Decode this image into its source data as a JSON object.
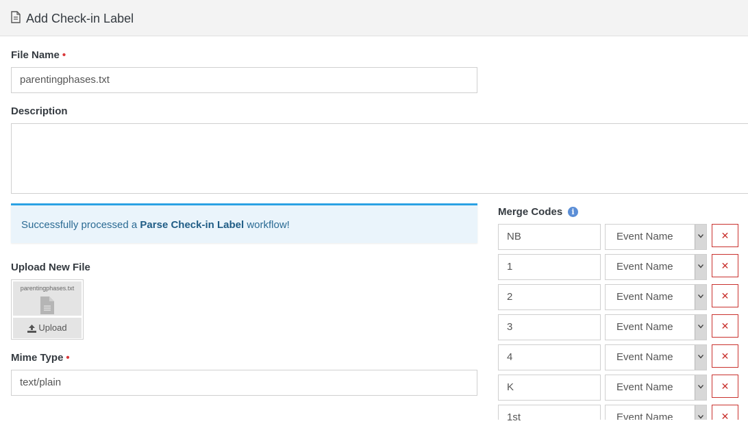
{
  "header": {
    "title": "Add Check-in Label",
    "icon": "file-text-icon"
  },
  "form": {
    "file_name": {
      "label": "File Name",
      "required_mark": "•",
      "value": "parentingphases.txt"
    },
    "description": {
      "label": "Description",
      "value": ""
    },
    "alert": {
      "prefix": "Successfully processed a ",
      "strong": "Parse Check-in Label",
      "suffix": " workflow!"
    },
    "upload": {
      "label": "Upload New File",
      "preview_filename": "parentingphases.txt",
      "button_label": "Upload"
    },
    "mime_type": {
      "label": "Mime Type",
      "required_mark": "•",
      "value": "text/plain"
    }
  },
  "merge_codes": {
    "label": "Merge Codes",
    "info_glyph": "i",
    "delete_glyph": "✕",
    "rows": [
      {
        "key": "NB",
        "selected": "Event Name"
      },
      {
        "key": "1",
        "selected": "Event Name"
      },
      {
        "key": "2",
        "selected": "Event Name"
      },
      {
        "key": "3",
        "selected": "Event Name"
      },
      {
        "key": "4",
        "selected": "Event Name"
      },
      {
        "key": "K",
        "selected": "Event Name"
      },
      {
        "key": "1st",
        "selected": "Event Name"
      }
    ]
  },
  "colors": {
    "required": "#d9383a",
    "alert_border": "#2aa1e3",
    "alert_bg": "#eaf4fb",
    "danger": "#c9302c",
    "info": "#5b8ed6"
  }
}
